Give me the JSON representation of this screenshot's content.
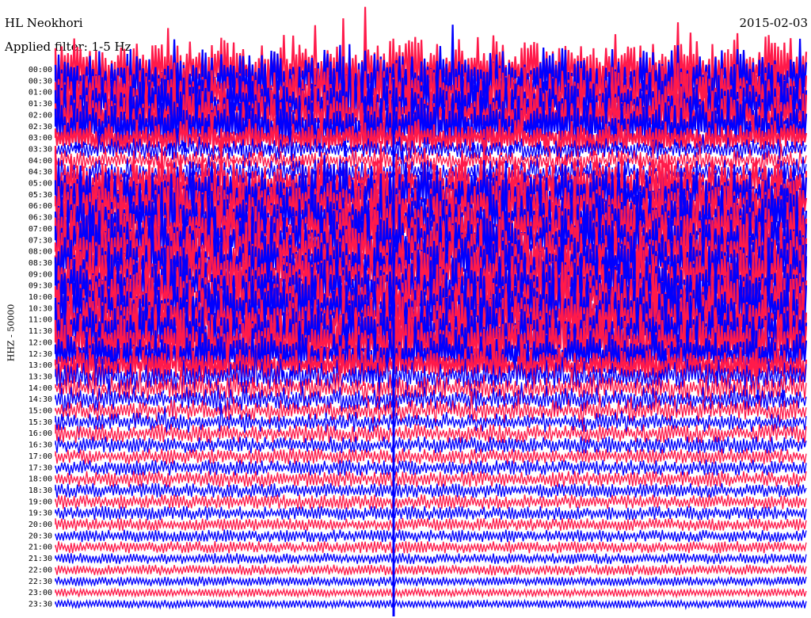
{
  "header": {
    "station": "HL Neokhori",
    "filter_label": "Applied filter: 1-5 Hz",
    "date": "2015-02-03"
  },
  "colors": {
    "trace_a": "#0000ff",
    "trace_b": "#ff1a4a",
    "background": "#ffffff"
  },
  "chart_data": {
    "type": "line",
    "ylabel": "HHZ - 50000",
    "row_times": [
      "00:00",
      "00:30",
      "01:00",
      "01:30",
      "02:00",
      "02:30",
      "03:00",
      "03:30",
      "04:00",
      "04:30",
      "05:00",
      "05:30",
      "06:00",
      "06:30",
      "07:00",
      "07:30",
      "08:00",
      "08:30",
      "09:00",
      "09:30",
      "10:00",
      "10:30",
      "11:00",
      "11:30",
      "12:00",
      "12:30",
      "13:00",
      "13:30",
      "14:00",
      "14:30",
      "15:00",
      "15:30",
      "16:00",
      "16:30",
      "17:00",
      "17:30",
      "18:00",
      "18:30",
      "19:00",
      "19:30",
      "20:00",
      "20:30",
      "21:00",
      "21:30",
      "22:00",
      "22:30",
      "23:00",
      "23:30"
    ],
    "row_amplitude": [
      1.0,
      1.0,
      0.95,
      0.95,
      0.9,
      0.9,
      0.55,
      0.35,
      0.35,
      0.4,
      0.9,
      0.95,
      1.0,
      1.0,
      1.0,
      1.0,
      1.0,
      1.0,
      1.0,
      1.0,
      1.0,
      1.0,
      1.0,
      1.0,
      1.0,
      0.75,
      0.6,
      0.5,
      0.45,
      0.4,
      0.35,
      0.3,
      0.25,
      0.22,
      0.2,
      0.2,
      0.2,
      0.18,
      0.18,
      0.17,
      0.15,
      0.15,
      0.14,
      0.12,
      0.12,
      0.1,
      0.08,
      0.08
    ]
  }
}
